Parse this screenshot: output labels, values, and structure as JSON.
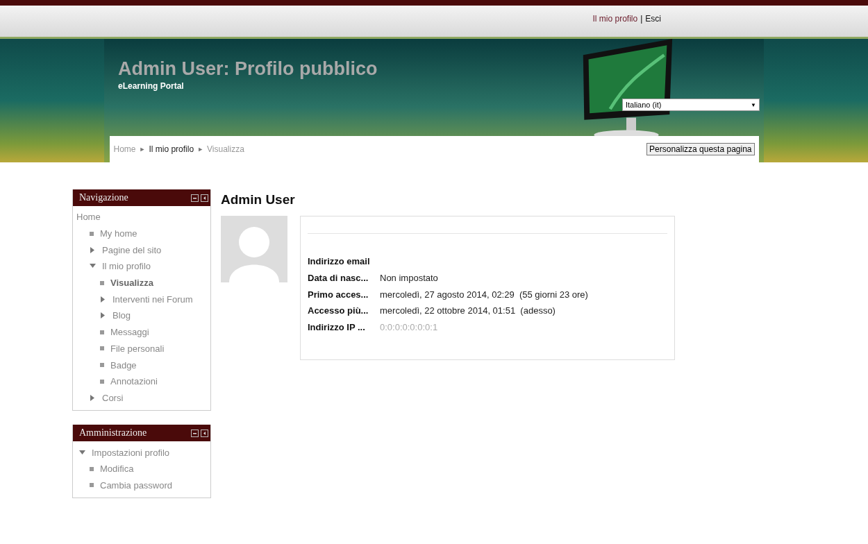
{
  "top_links": {
    "profile": "Il mio profilo",
    "separator": "|",
    "logout": "Esci"
  },
  "header": {
    "title": "Admin User: Profilo pubblico",
    "subtitle": "eLearning Portal",
    "language": "Italiano (it)",
    "language_caret": "▼"
  },
  "breadcrumb": [
    {
      "label": "Home",
      "selected": false
    },
    {
      "label": "Il mio profilo",
      "selected": true
    },
    {
      "label": "Visualizza",
      "selected": false
    }
  ],
  "breadcrumb_separator": "►",
  "customize_button": "Personalizza questa pagina",
  "blocks": [
    {
      "title": "Navigazione",
      "items": [
        {
          "label": "Home",
          "kind": "root",
          "selected": false,
          "children": [
            {
              "label": "My home",
              "kind": "leaf",
              "selected": false
            },
            {
              "label": "Pagine del sito",
              "kind": "branch",
              "expanded": false,
              "selected": false
            },
            {
              "label": "Il mio profilo",
              "kind": "branch",
              "expanded": true,
              "selected": false,
              "children": [
                {
                  "label": "Visualizza",
                  "kind": "leaf",
                  "selected": true
                },
                {
                  "label": "Interventi nei Forum",
                  "kind": "branch",
                  "expanded": false,
                  "selected": false
                },
                {
                  "label": "Blog",
                  "kind": "branch",
                  "expanded": false,
                  "selected": false
                },
                {
                  "label": "Messaggi",
                  "kind": "leaf",
                  "selected": false
                },
                {
                  "label": "File personali",
                  "kind": "leaf",
                  "selected": false
                },
                {
                  "label": "Badge",
                  "kind": "leaf",
                  "selected": false
                },
                {
                  "label": "Annotazioni",
                  "kind": "leaf",
                  "selected": false
                }
              ]
            },
            {
              "label": "Corsi",
              "kind": "branch",
              "expanded": false,
              "selected": false
            }
          ]
        }
      ]
    },
    {
      "title": "Amministrazione",
      "items": [
        {
          "label": "Impostazioni profilo",
          "kind": "branch",
          "expanded": true,
          "selected": false,
          "children": [
            {
              "label": "Modifica",
              "kind": "leaf",
              "selected": false
            },
            {
              "label": "Cambia password",
              "kind": "leaf",
              "selected": false
            }
          ]
        }
      ]
    }
  ],
  "profile": {
    "name": "Admin User",
    "fields": [
      {
        "label": "Indirizzo email"
      },
      {
        "label": "Data di nasc...",
        "value": "Non impostato",
        "kind": "text"
      },
      {
        "label": "Primo acces...",
        "value": "mercoledì, 27 agosto 2014, 02:29  (55 giorni 23 ore)",
        "kind": "text"
      },
      {
        "label": "Accesso più...",
        "value": "mercoledì, 22 ottobre 2014, 01:51  (adesso)",
        "kind": "text"
      },
      {
        "label": "Indirizzo IP ...",
        "value": "0:0:0:0:0:0:0:1",
        "kind": "link"
      }
    ]
  }
}
